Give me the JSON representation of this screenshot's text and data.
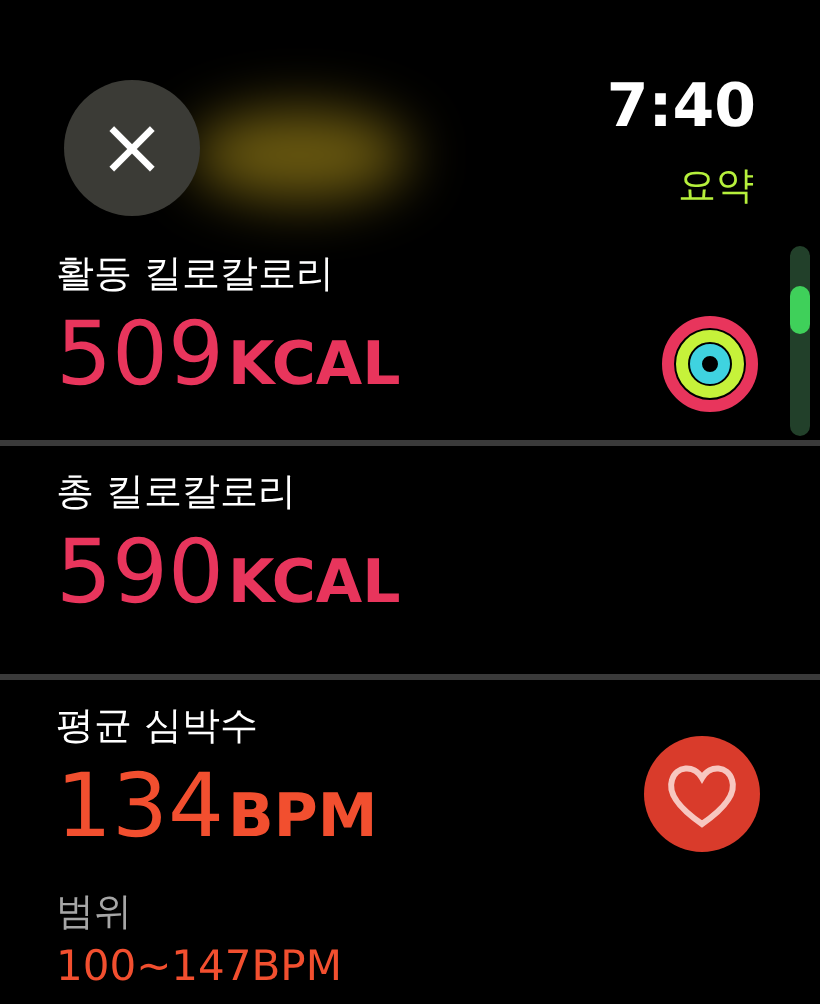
{
  "header": {
    "close_label": "×",
    "time": "7:40",
    "title": "요약"
  },
  "metrics": [
    {
      "kind": "rings",
      "label": "활동 킬로칼로리",
      "value": "509",
      "unit": "KCAL",
      "color": "#e8355c"
    },
    {
      "kind": "plain",
      "label": "총 킬로칼로리",
      "value": "590",
      "unit": "KCAL",
      "color": "#e8355c"
    },
    {
      "kind": "heart",
      "label": "평균 심박수",
      "value": "134",
      "unit": "BPM",
      "color": "#f24f2f",
      "sub_label": "범위",
      "sub_value": "100~147BPM"
    }
  ]
}
